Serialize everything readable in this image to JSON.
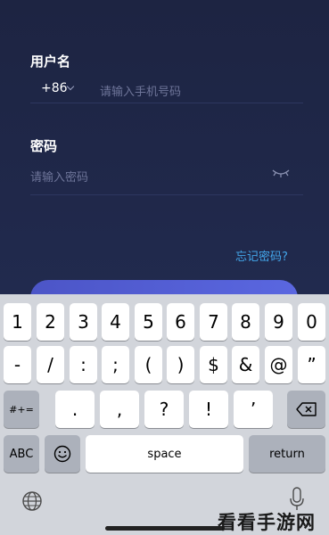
{
  "form": {
    "username_label": "用户名",
    "country_code": "+86",
    "phone_placeholder": "请输入手机号码",
    "password_label": "密码",
    "password_placeholder": "请输入密码",
    "forgot_password": "忘记密码?"
  },
  "keyboard": {
    "row1": [
      "1",
      "2",
      "3",
      "4",
      "5",
      "6",
      "7",
      "8",
      "9",
      "0"
    ],
    "row2": [
      "-",
      "/",
      ":",
      ";",
      "(",
      ")",
      "$",
      "&",
      "@",
      "”"
    ],
    "row3_mode": "#+=",
    "row3": [
      ".",
      ",",
      "?",
      "!",
      "’"
    ],
    "abc": "ABC",
    "space": "space",
    "return": "return"
  },
  "watermark": "看看手游网",
  "colors": {
    "background": "#1e2546",
    "accent": "#43a6ea",
    "button": "#5a67e0",
    "keyboard": "#d2d5db"
  }
}
